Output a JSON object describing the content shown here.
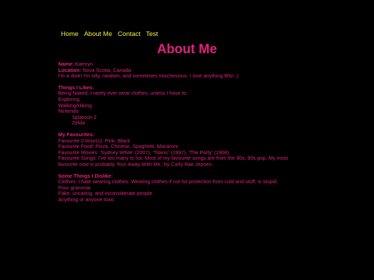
{
  "nav": {
    "items": [
      "Home",
      "About Me",
      "Contact",
      "Test"
    ]
  },
  "page": {
    "title": "About Me"
  },
  "profile": {
    "name_label": "Name:",
    "name_value": " Kamryn",
    "location_label": "Location:",
    "location_value": " Nova Scotia, Canada",
    "bio": "I'm a dork! I'm silly, random, and sometimes mischevious. I love anything 90s! :)"
  },
  "likes": {
    "heading": "Things I Likes:",
    "items": [
      "Being Naked: I rarely ever wear clothes, unless I have to.",
      "Exploring",
      "Walking/Hiking",
      "Nintendo"
    ],
    "nintendo_sub": [
      "Splatoon 2",
      "Zelda"
    ]
  },
  "favourites": {
    "heading": "My Favourites:",
    "colours": "Favourite Colour(s): Pink, Black",
    "food": "Favourite Food: Pizza, Chinese, Spaghetti, Macaroni",
    "movies": "Favourite Movies: 'Sydney White' (2007), 'Titanic' (1997), 'The Party' (1968)",
    "songs": "Favourite Songs: I've too many to list. Most of my favourite songs are from the 90s; 90s pop. My most favourite now is probably 'Run Away With Me,' by Carly Rae Jepsen."
  },
  "dislikes": {
    "heading": "Some Things I Dislike:",
    "items": [
      "Clothes: I hate wearing clothes. Wearing clothes if not for protection from cold and stuff, is stupid.",
      "Poor grammar",
      "Fake, uncaring, and inconsiderate people",
      "Anything or anyone toxic"
    ]
  },
  "colors": {
    "background": "#000000",
    "text": "#e0207e",
    "nav_link": "#f2f24a"
  }
}
